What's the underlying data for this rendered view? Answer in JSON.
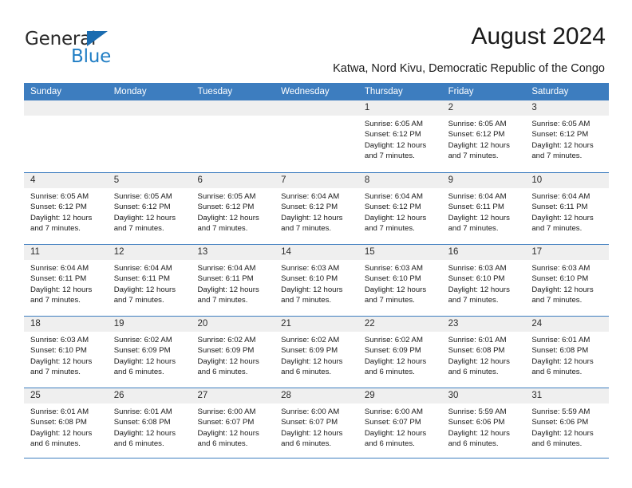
{
  "brand": {
    "logo_text_1": "General",
    "logo_text_2": "Blue",
    "logo_triangle_icon": "triangle-icon",
    "accent_blue": "#1f7dc4",
    "logo_dark": "#2b2b2b"
  },
  "header": {
    "title": "August 2024",
    "subtitle": "Katwa, Nord Kivu, Democratic Republic of the Congo"
  },
  "calendar": {
    "header_background": "#3d7dbf",
    "day_band_background": "#efefef",
    "weekdays": [
      "Sunday",
      "Monday",
      "Tuesday",
      "Wednesday",
      "Thursday",
      "Friday",
      "Saturday"
    ],
    "weeks": [
      [
        {
          "day": "",
          "empty": true
        },
        {
          "day": "",
          "empty": true
        },
        {
          "day": "",
          "empty": true
        },
        {
          "day": "",
          "empty": true
        },
        {
          "day": "1",
          "sunrise": "Sunrise: 6:05 AM",
          "sunset": "Sunset: 6:12 PM",
          "daylight_1": "Daylight: 12 hours",
          "daylight_2": "and 7 minutes."
        },
        {
          "day": "2",
          "sunrise": "Sunrise: 6:05 AM",
          "sunset": "Sunset: 6:12 PM",
          "daylight_1": "Daylight: 12 hours",
          "daylight_2": "and 7 minutes."
        },
        {
          "day": "3",
          "sunrise": "Sunrise: 6:05 AM",
          "sunset": "Sunset: 6:12 PM",
          "daylight_1": "Daylight: 12 hours",
          "daylight_2": "and 7 minutes."
        }
      ],
      [
        {
          "day": "4",
          "sunrise": "Sunrise: 6:05 AM",
          "sunset": "Sunset: 6:12 PM",
          "daylight_1": "Daylight: 12 hours",
          "daylight_2": "and 7 minutes."
        },
        {
          "day": "5",
          "sunrise": "Sunrise: 6:05 AM",
          "sunset": "Sunset: 6:12 PM",
          "daylight_1": "Daylight: 12 hours",
          "daylight_2": "and 7 minutes."
        },
        {
          "day": "6",
          "sunrise": "Sunrise: 6:05 AM",
          "sunset": "Sunset: 6:12 PM",
          "daylight_1": "Daylight: 12 hours",
          "daylight_2": "and 7 minutes."
        },
        {
          "day": "7",
          "sunrise": "Sunrise: 6:04 AM",
          "sunset": "Sunset: 6:12 PM",
          "daylight_1": "Daylight: 12 hours",
          "daylight_2": "and 7 minutes."
        },
        {
          "day": "8",
          "sunrise": "Sunrise: 6:04 AM",
          "sunset": "Sunset: 6:12 PM",
          "daylight_1": "Daylight: 12 hours",
          "daylight_2": "and 7 minutes."
        },
        {
          "day": "9",
          "sunrise": "Sunrise: 6:04 AM",
          "sunset": "Sunset: 6:11 PM",
          "daylight_1": "Daylight: 12 hours",
          "daylight_2": "and 7 minutes."
        },
        {
          "day": "10",
          "sunrise": "Sunrise: 6:04 AM",
          "sunset": "Sunset: 6:11 PM",
          "daylight_1": "Daylight: 12 hours",
          "daylight_2": "and 7 minutes."
        }
      ],
      [
        {
          "day": "11",
          "sunrise": "Sunrise: 6:04 AM",
          "sunset": "Sunset: 6:11 PM",
          "daylight_1": "Daylight: 12 hours",
          "daylight_2": "and 7 minutes."
        },
        {
          "day": "12",
          "sunrise": "Sunrise: 6:04 AM",
          "sunset": "Sunset: 6:11 PM",
          "daylight_1": "Daylight: 12 hours",
          "daylight_2": "and 7 minutes."
        },
        {
          "day": "13",
          "sunrise": "Sunrise: 6:04 AM",
          "sunset": "Sunset: 6:11 PM",
          "daylight_1": "Daylight: 12 hours",
          "daylight_2": "and 7 minutes."
        },
        {
          "day": "14",
          "sunrise": "Sunrise: 6:03 AM",
          "sunset": "Sunset: 6:10 PM",
          "daylight_1": "Daylight: 12 hours",
          "daylight_2": "and 7 minutes."
        },
        {
          "day": "15",
          "sunrise": "Sunrise: 6:03 AM",
          "sunset": "Sunset: 6:10 PM",
          "daylight_1": "Daylight: 12 hours",
          "daylight_2": "and 7 minutes."
        },
        {
          "day": "16",
          "sunrise": "Sunrise: 6:03 AM",
          "sunset": "Sunset: 6:10 PM",
          "daylight_1": "Daylight: 12 hours",
          "daylight_2": "and 7 minutes."
        },
        {
          "day": "17",
          "sunrise": "Sunrise: 6:03 AM",
          "sunset": "Sunset: 6:10 PM",
          "daylight_1": "Daylight: 12 hours",
          "daylight_2": "and 7 minutes."
        }
      ],
      [
        {
          "day": "18",
          "sunrise": "Sunrise: 6:03 AM",
          "sunset": "Sunset: 6:10 PM",
          "daylight_1": "Daylight: 12 hours",
          "daylight_2": "and 7 minutes."
        },
        {
          "day": "19",
          "sunrise": "Sunrise: 6:02 AM",
          "sunset": "Sunset: 6:09 PM",
          "daylight_1": "Daylight: 12 hours",
          "daylight_2": "and 6 minutes."
        },
        {
          "day": "20",
          "sunrise": "Sunrise: 6:02 AM",
          "sunset": "Sunset: 6:09 PM",
          "daylight_1": "Daylight: 12 hours",
          "daylight_2": "and 6 minutes."
        },
        {
          "day": "21",
          "sunrise": "Sunrise: 6:02 AM",
          "sunset": "Sunset: 6:09 PM",
          "daylight_1": "Daylight: 12 hours",
          "daylight_2": "and 6 minutes."
        },
        {
          "day": "22",
          "sunrise": "Sunrise: 6:02 AM",
          "sunset": "Sunset: 6:09 PM",
          "daylight_1": "Daylight: 12 hours",
          "daylight_2": "and 6 minutes."
        },
        {
          "day": "23",
          "sunrise": "Sunrise: 6:01 AM",
          "sunset": "Sunset: 6:08 PM",
          "daylight_1": "Daylight: 12 hours",
          "daylight_2": "and 6 minutes."
        },
        {
          "day": "24",
          "sunrise": "Sunrise: 6:01 AM",
          "sunset": "Sunset: 6:08 PM",
          "daylight_1": "Daylight: 12 hours",
          "daylight_2": "and 6 minutes."
        }
      ],
      [
        {
          "day": "25",
          "sunrise": "Sunrise: 6:01 AM",
          "sunset": "Sunset: 6:08 PM",
          "daylight_1": "Daylight: 12 hours",
          "daylight_2": "and 6 minutes."
        },
        {
          "day": "26",
          "sunrise": "Sunrise: 6:01 AM",
          "sunset": "Sunset: 6:08 PM",
          "daylight_1": "Daylight: 12 hours",
          "daylight_2": "and 6 minutes."
        },
        {
          "day": "27",
          "sunrise": "Sunrise: 6:00 AM",
          "sunset": "Sunset: 6:07 PM",
          "daylight_1": "Daylight: 12 hours",
          "daylight_2": "and 6 minutes."
        },
        {
          "day": "28",
          "sunrise": "Sunrise: 6:00 AM",
          "sunset": "Sunset: 6:07 PM",
          "daylight_1": "Daylight: 12 hours",
          "daylight_2": "and 6 minutes."
        },
        {
          "day": "29",
          "sunrise": "Sunrise: 6:00 AM",
          "sunset": "Sunset: 6:07 PM",
          "daylight_1": "Daylight: 12 hours",
          "daylight_2": "and 6 minutes."
        },
        {
          "day": "30",
          "sunrise": "Sunrise: 5:59 AM",
          "sunset": "Sunset: 6:06 PM",
          "daylight_1": "Daylight: 12 hours",
          "daylight_2": "and 6 minutes."
        },
        {
          "day": "31",
          "sunrise": "Sunrise: 5:59 AM",
          "sunset": "Sunset: 6:06 PM",
          "daylight_1": "Daylight: 12 hours",
          "daylight_2": "and 6 minutes."
        }
      ]
    ]
  }
}
